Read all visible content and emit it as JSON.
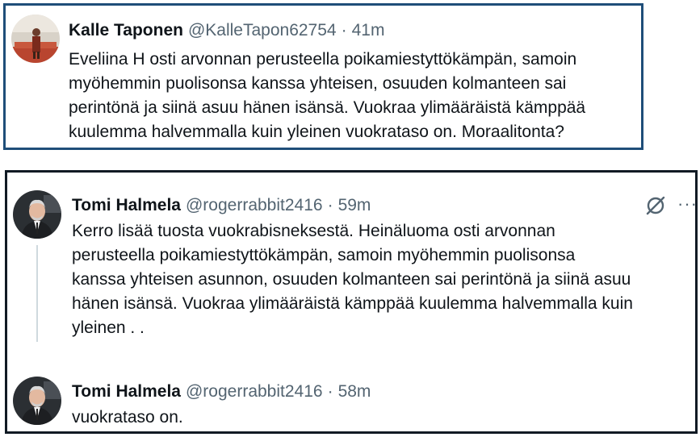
{
  "tweet1": {
    "name": "Kalle Taponen",
    "handle": "@KalleTapon62754",
    "separator": "·",
    "time": "41m",
    "text": "Eveliina H osti arvonnan perusteella  poikamiestyttökämpän, samoin\nmyöhemmin puolisonsa kanssa yhteisen, osuuden kolmanteen sai\nperintönä ja siinä asuu hänen isänsä. Vuokraa ylimääräistä kämppää\nkuulemma halvemmalla kuin yleinen vuokrataso on. Moraalitonta?"
  },
  "tweet2": {
    "name": "Tomi Halmela",
    "handle": "@rogerrabbit2416",
    "separator": "·",
    "time": "59m",
    "text": "Kerro lisää tuosta vuokrabisneksestä. Heinäluoma osti arvonnan\nperusteella poikamiestyttökämpän, samoin myöhemmin puolisonsa\nkanssa yhteisen asunnon, osuuden kolmanteen sai perintönä ja siinä asuu\nhänen isänsä. Vuokraa ylimääräistä kämppää kuulemma halvemmalla kuin\nyleinen . ."
  },
  "tweet3": {
    "name": "Tomi Halmela",
    "handle": "@rogerrabbit2416",
    "separator": "·",
    "time": "58m",
    "text": "vuokrataso on."
  },
  "icons": {
    "more": "more-horizontal-icon",
    "grok": "grok-icon"
  },
  "colors": {
    "frame1": "#1f4e79",
    "frame2": "#111a24",
    "secondary_text": "#536471"
  }
}
